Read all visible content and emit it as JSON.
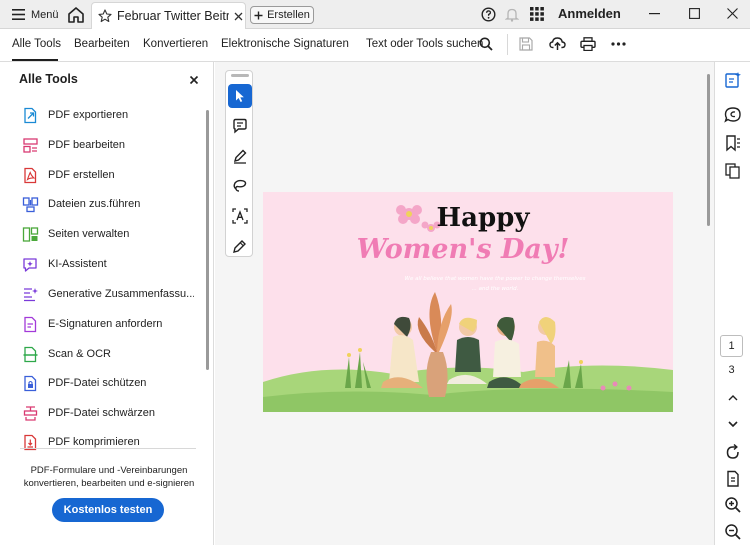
{
  "titlebar": {
    "menu_label": "Menü",
    "tab_title": "Februar Twitter Beitr...",
    "create_label": "Erstellen",
    "login_label": "Anmelden"
  },
  "toolbar": {
    "items": [
      "Alle Tools",
      "Bearbeiten",
      "Konvertieren",
      "Elektronische Signaturen"
    ],
    "search_label": "Text oder Tools suchen"
  },
  "left_panel": {
    "title": "Alle Tools",
    "tools": [
      {
        "label": "PDF exportieren",
        "icon": "export-pdf-icon",
        "color": "#1a8ad4"
      },
      {
        "label": "PDF bearbeiten",
        "icon": "edit-pdf-icon",
        "color": "#d93a72"
      },
      {
        "label": "PDF erstellen",
        "icon": "create-pdf-icon",
        "color": "#d93838"
      },
      {
        "label": "Dateien zus.führen",
        "icon": "combine-files-icon",
        "color": "#3a5fd9"
      },
      {
        "label": "Seiten verwalten",
        "icon": "organize-pages-icon",
        "color": "#4aa83a"
      },
      {
        "label": "KI-Assistent",
        "icon": "ai-assistant-icon",
        "color": "#7a3ad9"
      },
      {
        "label": "Generative Zusammenfassu...",
        "icon": "generative-summary-icon",
        "color": "#7a3ad9"
      },
      {
        "label": "E-Signaturen anfordern",
        "icon": "request-esign-icon",
        "color": "#a23ad9"
      },
      {
        "label": "Scan & OCR",
        "icon": "scan-ocr-icon",
        "color": "#2ea84a"
      },
      {
        "label": "PDF-Datei schützen",
        "icon": "protect-pdf-icon",
        "color": "#3a5fd9"
      },
      {
        "label": "PDF-Datei schwärzen",
        "icon": "redact-pdf-icon",
        "color": "#d93a72"
      },
      {
        "label": "PDF komprimieren",
        "icon": "compress-pdf-icon",
        "color": "#d93838"
      }
    ],
    "promo_text": "PDF-Formulare und -Vereinbarungen konvertieren, bearbeiten und e-signieren",
    "promo_button": "Kostenlos testen"
  },
  "document": {
    "headline_1": "Happy",
    "headline_2": "Women's Day!",
    "quote_line_1": "We all believe that women have the power to change themselves",
    "quote_line_2": "... and the world."
  },
  "page_nav": {
    "current_page": "1",
    "total_pages": "3"
  },
  "colors": {
    "accent": "#1767d2",
    "page_background": "#fde0eb",
    "headline_pink": "#f07cb4"
  }
}
